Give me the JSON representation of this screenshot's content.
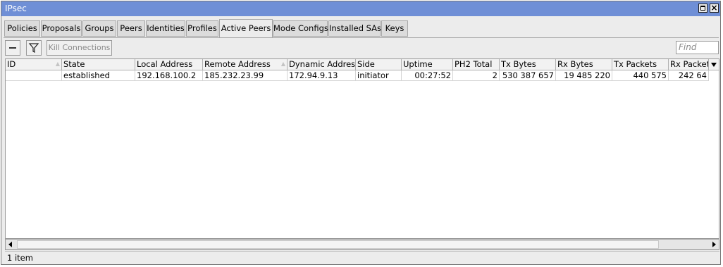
{
  "window": {
    "title": "IPsec"
  },
  "tabs": [
    {
      "label": "Policies",
      "active": false
    },
    {
      "label": "Proposals",
      "active": false
    },
    {
      "label": "Groups",
      "active": false
    },
    {
      "label": "Peers",
      "active": false
    },
    {
      "label": "Identities",
      "active": false
    },
    {
      "label": "Profiles",
      "active": false
    },
    {
      "label": "Active Peers",
      "active": true
    },
    {
      "label": "Mode Configs",
      "active": false
    },
    {
      "label": "Installed SAs",
      "active": false
    },
    {
      "label": "Keys",
      "active": false
    }
  ],
  "toolbar": {
    "minus_icon": "minus-icon",
    "filter_icon": "filter-icon",
    "kill_label": "Kill Connections",
    "find_placeholder": "Find"
  },
  "table": {
    "columns": [
      "ID",
      "State",
      "Local Address",
      "Remote Address",
      "Dynamic Address",
      "Side",
      "Uptime",
      "PH2 Total",
      "Tx Bytes",
      "Rx Bytes",
      "Tx Packets",
      "Rx Packets"
    ],
    "sorted_columns": [
      "ID",
      "Remote Address"
    ],
    "rows": [
      {
        "id": "",
        "state": "established",
        "local_address": "192.168.100.2",
        "remote_address": "185.232.23.99",
        "dynamic_address": "172.94.9.13",
        "side": "initiator",
        "uptime": "00:27:52",
        "ph2_total": "2",
        "tx_bytes": "530 387 657",
        "rx_bytes": "19 485 220",
        "tx_packets": "440 575",
        "rx_packets": "242 64"
      }
    ]
  },
  "status": {
    "count": "1 item"
  }
}
